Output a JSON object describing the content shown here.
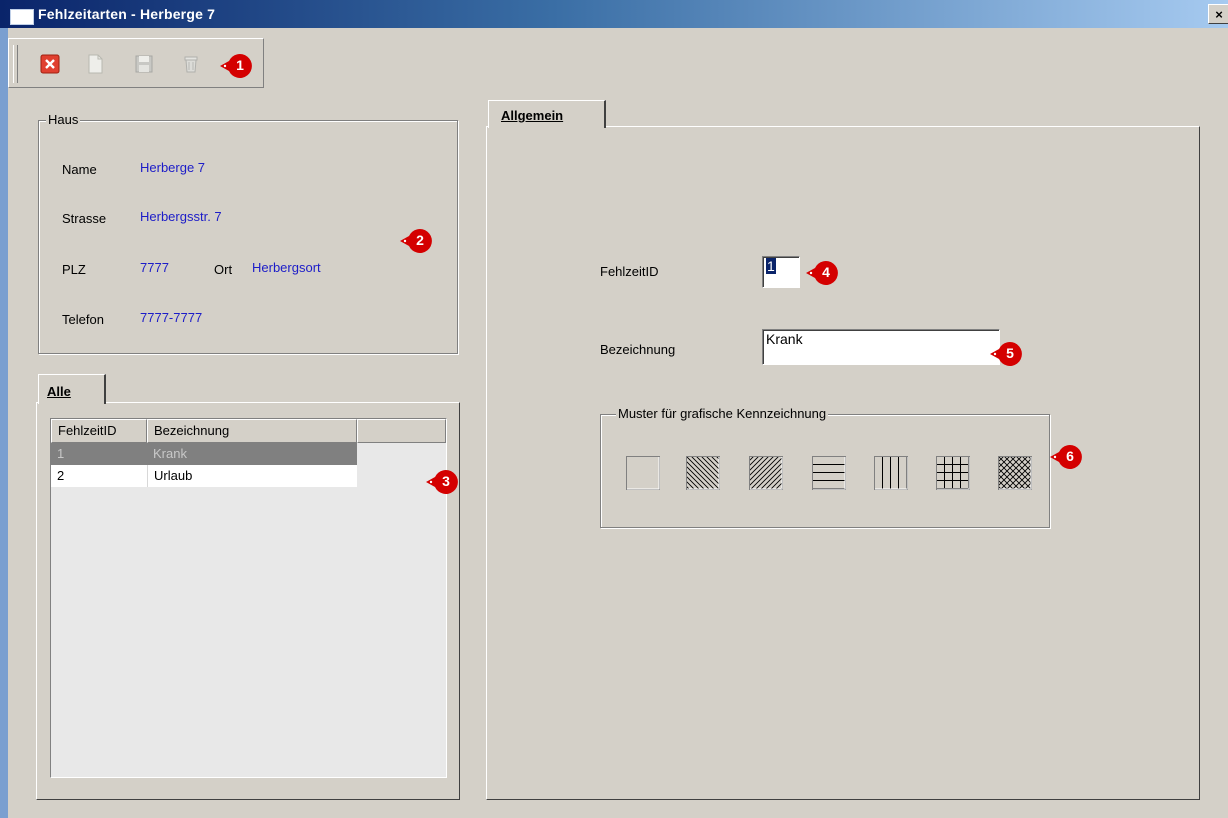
{
  "window": {
    "title": "Fehlzeitarten - Herberge 7",
    "close_glyph": "×"
  },
  "toolbar": {
    "icons": [
      "close-record-icon",
      "new-document-icon",
      "save-icon",
      "delete-icon"
    ]
  },
  "callouts": [
    "1",
    "2",
    "3",
    "4",
    "5",
    "6"
  ],
  "haus": {
    "legend": "Haus",
    "name_label": "Name",
    "name_value": "Herberge 7",
    "strasse_label": "Strasse",
    "strasse_value": "Herbergsstr. 7",
    "plz_label": "PLZ",
    "plz_value": "7777",
    "ort_label": "Ort",
    "ort_value": "Herbergsort",
    "telefon_label": "Telefon",
    "telefon_value": "7777-7777"
  },
  "left_tab": {
    "label": "Alle"
  },
  "list": {
    "columns": [
      "FehlzeitID",
      "Bezeichnung"
    ],
    "rows": [
      {
        "id": "1",
        "bezeichnung": "Krank",
        "selected": true
      },
      {
        "id": "2",
        "bezeichnung": "Urlaub",
        "selected": false
      }
    ]
  },
  "right_tab": {
    "label": "Allgemein"
  },
  "form": {
    "fehlzeitid_label": "FehlzeitID",
    "fehlzeitid_value": "1",
    "bezeichnung_label": "Bezeichnung",
    "bezeichnung_value": "Krank",
    "muster_legend": "Muster für grafische Kennzeichnung",
    "patterns": [
      "none",
      "backward-diagonal",
      "forward-diagonal",
      "horizontal",
      "vertical",
      "cross",
      "diagonal-cross"
    ]
  },
  "colors": {
    "face": "#d4d0c8",
    "value_text": "#1c1cc8",
    "callout": "#d40000",
    "selection": "#808080"
  }
}
